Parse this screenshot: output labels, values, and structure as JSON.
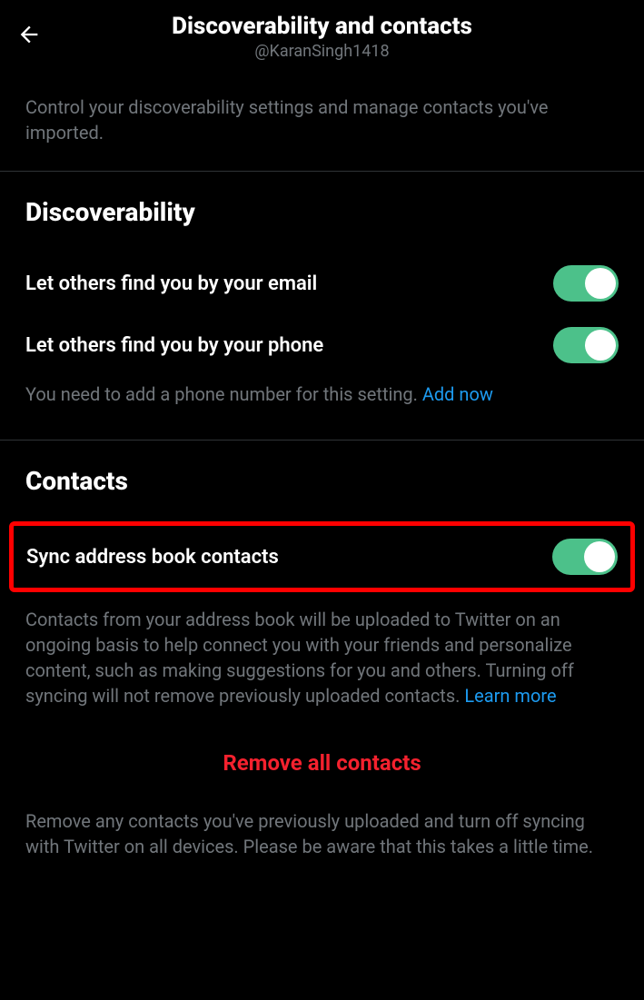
{
  "header": {
    "title": "Discoverability and contacts",
    "subtitle": "@KaranSingh1418"
  },
  "intro": "Control your discoverability settings and manage contacts you've imported.",
  "discoverability": {
    "heading": "Discoverability",
    "email_label": "Let others find you by your email",
    "phone_label": "Let others find you by your phone",
    "phone_help": "You need to add a phone number for this setting. ",
    "phone_link": "Add now"
  },
  "contacts": {
    "heading": "Contacts",
    "sync_label": "Sync address book contacts",
    "sync_help": "Contacts from your address book will be uploaded to Twitter on an ongoing basis to help connect you with your friends and personalize content, such as making suggestions for you and others. Turning off syncing will not remove previously uploaded contacts. ",
    "sync_link": "Learn more",
    "remove_label": "Remove all contacts",
    "remove_help": "Remove any contacts you've previously uploaded and turn off syncing with Twitter on all devices. Please be aware that this takes a little time."
  }
}
